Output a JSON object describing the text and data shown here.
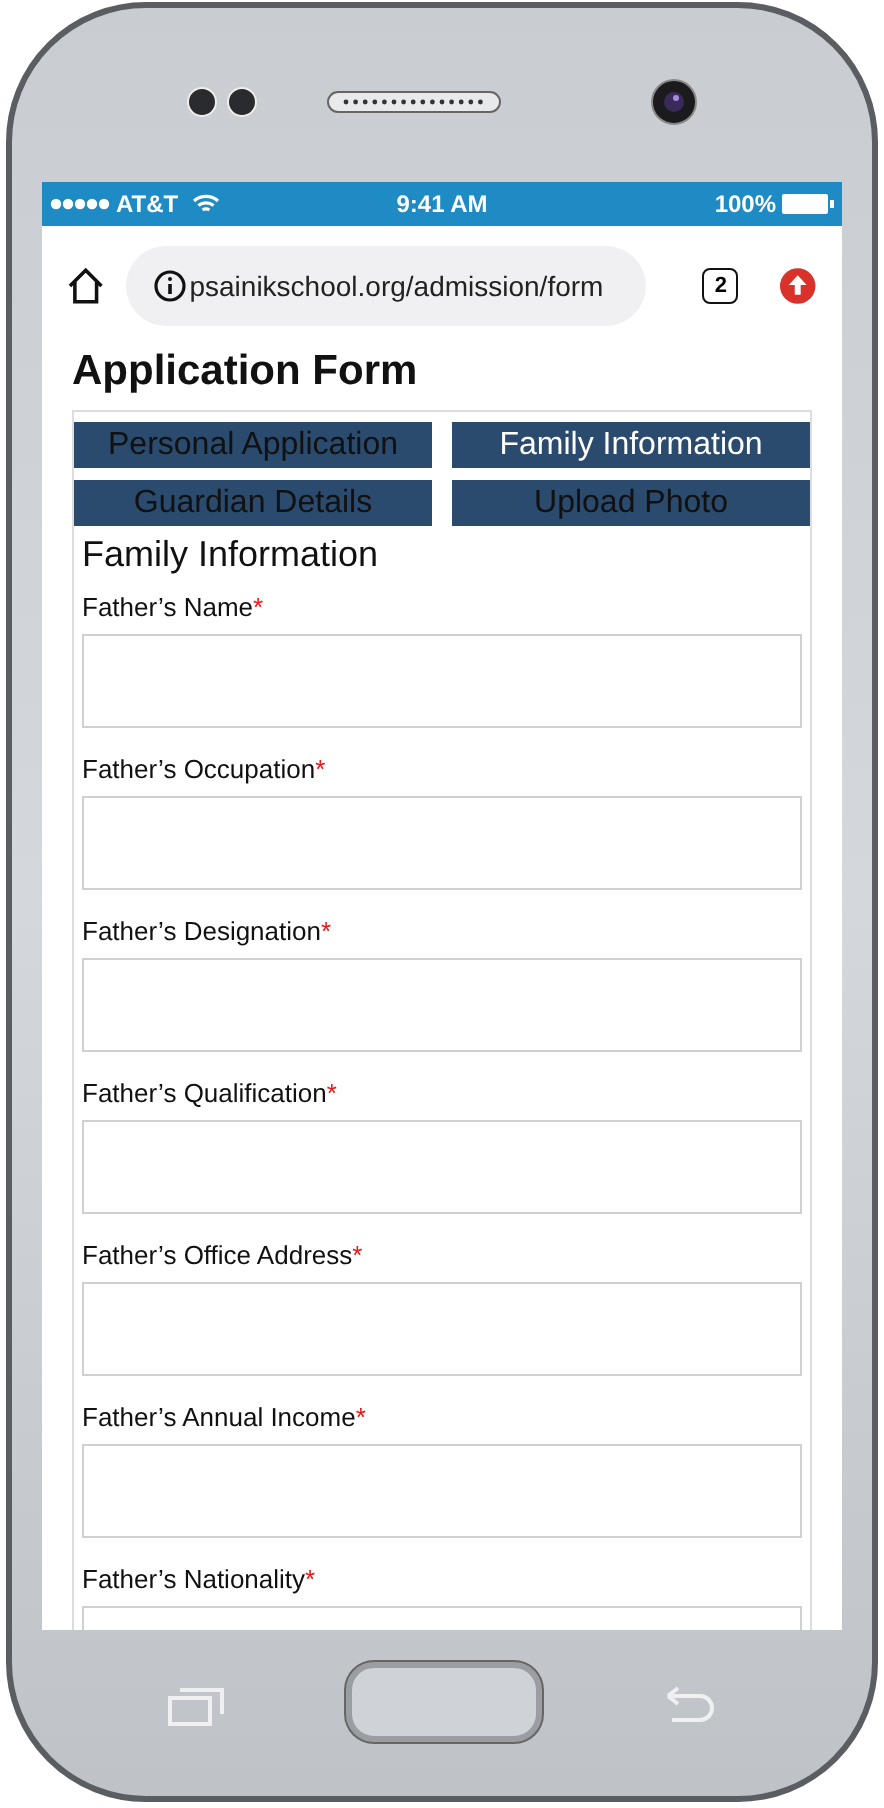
{
  "status_bar": {
    "carrier": "AT&T",
    "time": "9:41 AM",
    "battery": "100%"
  },
  "browser": {
    "url": "psainikschool.org/admission/form",
    "tab_count": "2"
  },
  "page": {
    "title": "Application Form",
    "tabs": [
      {
        "label": "Personal Application",
        "selected": false
      },
      {
        "label": "Family Information",
        "selected": true
      },
      {
        "label": "Guardian Details",
        "selected": false
      },
      {
        "label": "Upload Photo",
        "selected": false
      }
    ],
    "section_title": "Family Information",
    "fields": [
      {
        "label": "Father’s Name",
        "required_mark": "*"
      },
      {
        "label": "Father’s Occupation",
        "required_mark": "*"
      },
      {
        "label": "Father’s Designation",
        "required_mark": "*"
      },
      {
        "label": "Father’s Qualification",
        "required_mark": "*"
      },
      {
        "label": "Father’s Office Address",
        "required_mark": "*"
      },
      {
        "label": "Father’s Annual Income",
        "required_mark": "*"
      },
      {
        "label": "Father’s Nationality",
        "required_mark": "*"
      }
    ]
  }
}
